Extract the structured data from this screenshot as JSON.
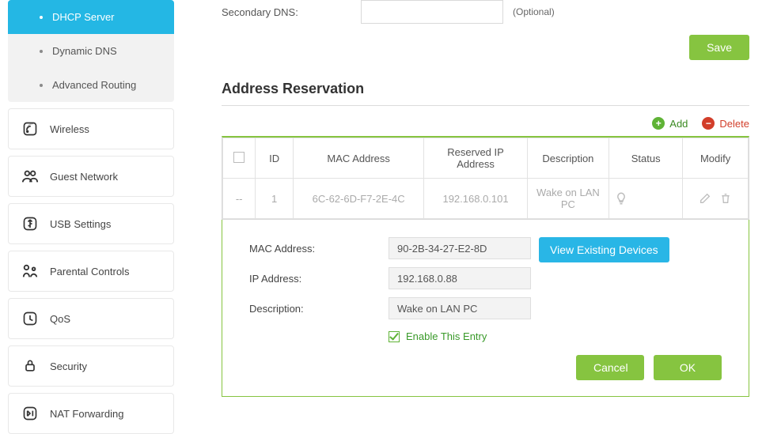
{
  "sidebar": {
    "sub": [
      "DHCP Server",
      "Dynamic DNS",
      "Advanced Routing"
    ],
    "items": [
      "Wireless",
      "Guest Network",
      "USB Settings",
      "Parental Controls",
      "QoS",
      "Security",
      "NAT Forwarding"
    ]
  },
  "form": {
    "secondary_dns_label": "Secondary DNS:",
    "secondary_dns_value": "",
    "optional": "(Optional)",
    "save": "Save"
  },
  "section_title": "Address Reservation",
  "actions": {
    "add": "Add",
    "delete": "Delete"
  },
  "table": {
    "headers": [
      "",
      "ID",
      "MAC Address",
      "Reserved IP Address",
      "Description",
      "Status",
      "Modify"
    ],
    "row": {
      "dash": "--",
      "id": "1",
      "mac": "6C-62-6D-F7-2E-4C",
      "ip": "192.168.0.101",
      "desc": "Wake on LAN PC"
    }
  },
  "panel": {
    "mac_label": "MAC Address:",
    "mac_value": "90-2B-34-27-E2-8D",
    "ip_label": "IP Address:",
    "ip_value": "192.168.0.88",
    "desc_label": "Description:",
    "desc_value": "Wake on LAN PC",
    "view_btn": "View Existing Devices",
    "enable": "Enable This Entry",
    "cancel": "Cancel",
    "ok": "OK"
  }
}
